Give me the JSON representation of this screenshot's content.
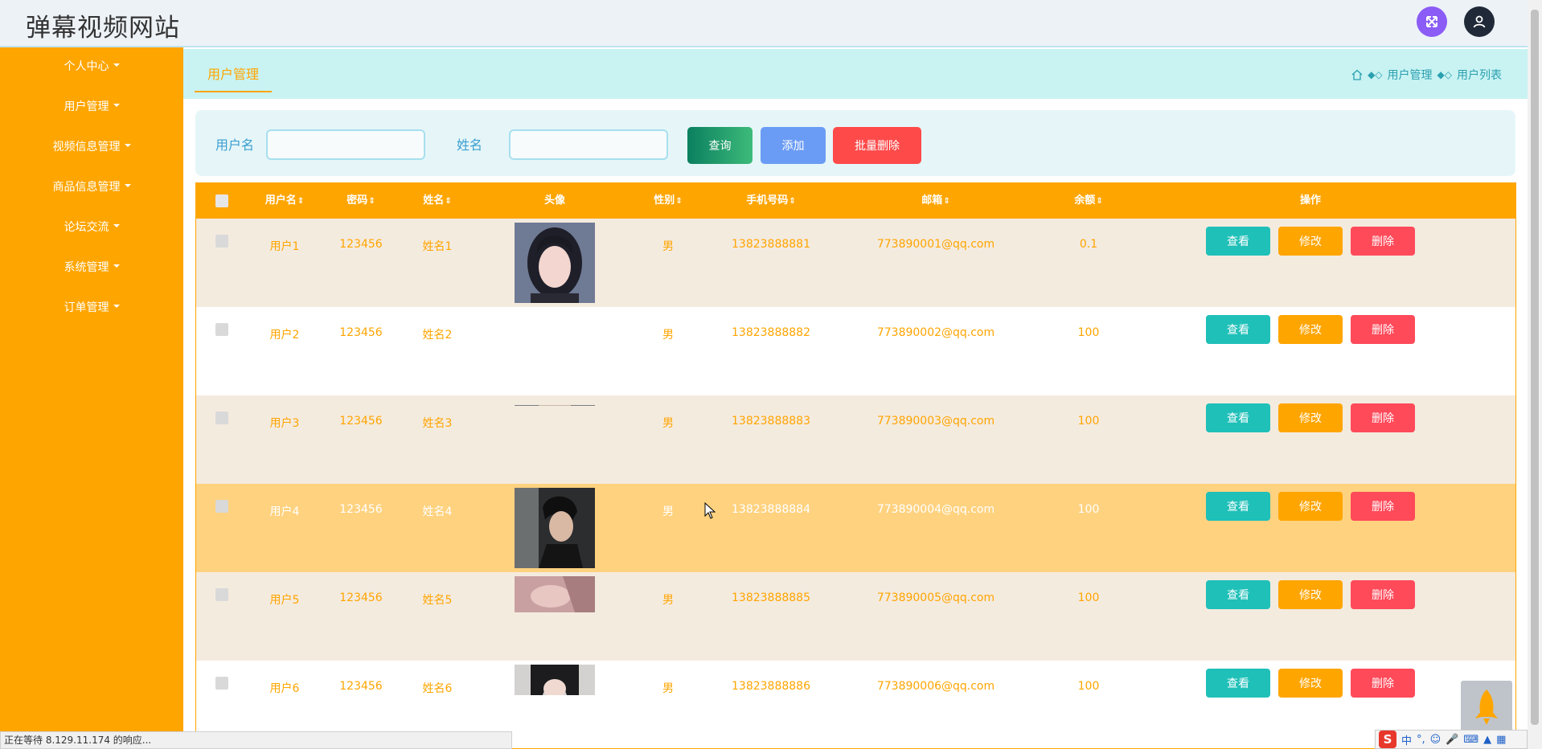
{
  "app": {
    "title": "弹幕视频网站"
  },
  "sidebar": {
    "items": [
      {
        "label": "个人中心"
      },
      {
        "label": "用户管理"
      },
      {
        "label": "视频信息管理"
      },
      {
        "label": "商品信息管理"
      },
      {
        "label": "论坛交流"
      },
      {
        "label": "系统管理"
      },
      {
        "label": "订单管理"
      }
    ]
  },
  "header": {
    "tab_label": "用户管理",
    "breadcrumb": [
      "用户管理",
      "用户列表"
    ]
  },
  "search": {
    "username_label": "用户名",
    "username_value": "",
    "name_label": "姓名",
    "name_value": "",
    "query_label": "查询",
    "add_label": "添加",
    "batch_delete_label": "批量删除"
  },
  "table": {
    "columns": [
      "用户名",
      "密码",
      "姓名",
      "头像",
      "性别",
      "手机号码",
      "邮箱",
      "余额",
      "操作"
    ],
    "rows": [
      {
        "username": "用户1",
        "password": "123456",
        "name": "姓名1",
        "gender": "男",
        "phone": "13823888881",
        "email": "773890001@qq.com",
        "balance": "0.1"
      },
      {
        "username": "用户2",
        "password": "123456",
        "name": "姓名2",
        "gender": "男",
        "phone": "13823888882",
        "email": "773890002@qq.com",
        "balance": "100"
      },
      {
        "username": "用户3",
        "password": "123456",
        "name": "姓名3",
        "gender": "男",
        "phone": "13823888883",
        "email": "773890003@qq.com",
        "balance": "100"
      },
      {
        "username": "用户4",
        "password": "123456",
        "name": "姓名4",
        "gender": "男",
        "phone": "13823888884",
        "email": "773890004@qq.com",
        "balance": "100"
      },
      {
        "username": "用户5",
        "password": "123456",
        "name": "姓名5",
        "gender": "男",
        "phone": "13823888885",
        "email": "773890005@qq.com",
        "balance": "100"
      },
      {
        "username": "用户6",
        "password": "123456",
        "name": "姓名6",
        "gender": "男",
        "phone": "13823888886",
        "email": "773890006@qq.com",
        "balance": "100"
      }
    ],
    "actions": {
      "view": "查看",
      "edit": "修改",
      "delete": "删除"
    }
  },
  "browser": {
    "status_text": "正在等待 8.129.11.174 的响应..."
  },
  "tray": {
    "ime_label": "中"
  },
  "colors": {
    "primary": "#ffa500",
    "view": "#1fc0b8",
    "delete": "#ff4a5a",
    "add": "#6b9cf5",
    "breadcrumb_bg": "#c8f3f2"
  }
}
